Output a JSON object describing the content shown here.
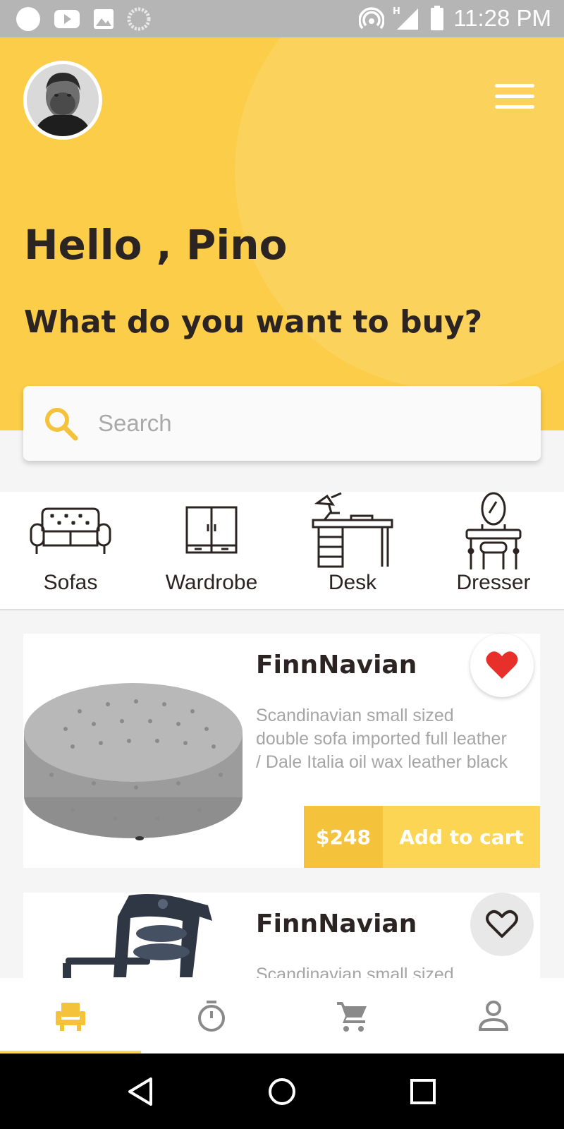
{
  "status_bar": {
    "time": "11:28 PM",
    "icons": [
      "circle-icon",
      "youtube-icon",
      "image-icon",
      "loading-icon",
      "hotspot-icon",
      "signal-icon",
      "battery-icon"
    ]
  },
  "header": {
    "greeting": "Hello , Pino",
    "question": "What do you want to buy?",
    "color": "#fbcd49"
  },
  "search": {
    "placeholder": "Search",
    "value": ""
  },
  "categories": [
    {
      "label": "Sofas",
      "icon": "sofa-icon"
    },
    {
      "label": "Wardrobe",
      "icon": "wardrobe-icon"
    },
    {
      "label": "Desk",
      "icon": "desk-icon"
    },
    {
      "label": "Dresser",
      "icon": "dresser-icon"
    }
  ],
  "products": [
    {
      "name": "FinnNavian",
      "description": "Scandinavian small sized double sofa imported full leather / Dale Italia oil wax leather black",
      "price": "$248",
      "cta": "Add to cart",
      "favorite": true
    },
    {
      "name": "FinnNavian",
      "description": "Scandinavian small sized",
      "favorite": false
    }
  ],
  "bottom_nav": {
    "items": [
      "furniture-icon",
      "timer-icon",
      "cart-icon",
      "profile-icon"
    ],
    "active": "furniture-icon",
    "active_color": "#f5c33b"
  }
}
